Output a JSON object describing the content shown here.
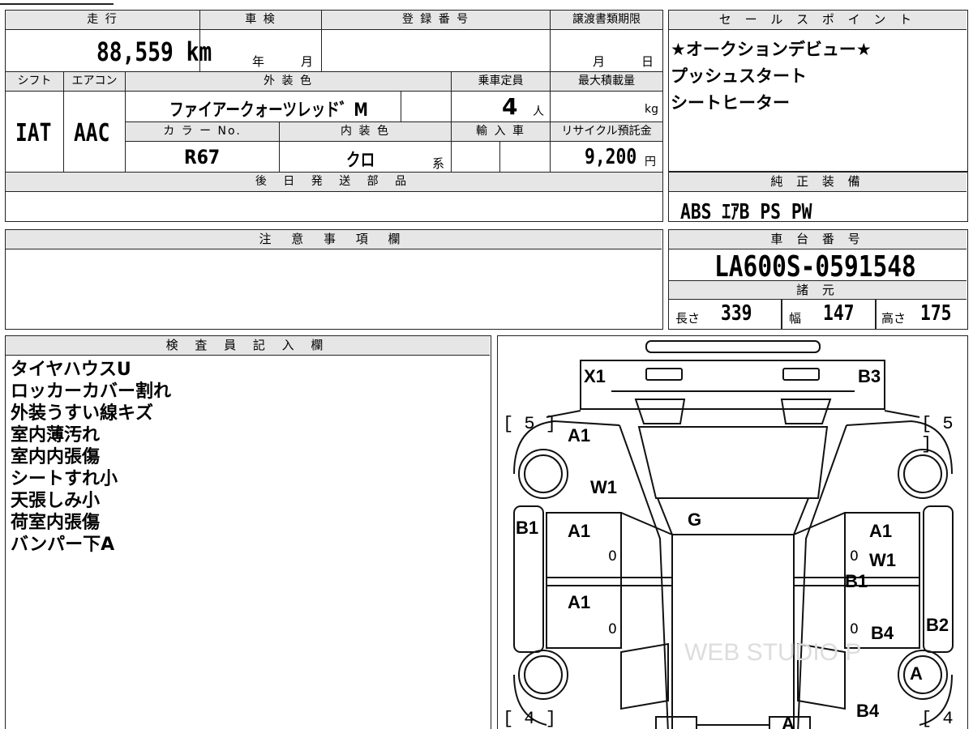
{
  "vehicle": {
    "mileage_label": "走 行",
    "mileage": "88,559",
    "mileage_unit": "km",
    "inspection_label": "車 検",
    "inspection_year": "年",
    "inspection_month": "月",
    "registration_label": "登 録 番 号",
    "transfer_label": "譲渡書類期限",
    "transfer_month": "月",
    "transfer_day": "日",
    "shift_label": "シフト",
    "shift": "IAT",
    "ac_label": "エアコン",
    "ac": "AAC",
    "exterior_label": "外 装 色",
    "exterior": "ファイアークォーツレッド゛M",
    "capacity_label": "乗車定員",
    "capacity": "4",
    "capacity_unit": "人",
    "max_load_label": "最大積載量",
    "max_load_unit": "kg",
    "color_no_label": "カ ラ ー No.",
    "color_no": "R67",
    "interior_label": "内 装 色",
    "interior": "クロ",
    "interior_unit": "系",
    "import_label": "輸 入 車",
    "recycle_label": "リサイクル預託金",
    "recycle": "9,200",
    "recycle_unit": "円",
    "later_parts_label": "後 日 発 送 部 品"
  },
  "sales_points": {
    "label": "セ ー ル ス ポ イ ン ト",
    "items": [
      "★オークションデビュー★",
      "プッシュスタート",
      "シートヒーター"
    ]
  },
  "equipment": {
    "label": "純 正 装 備",
    "value": "ABS ｴｱB PS PW"
  },
  "notes": {
    "label": "注 意 事 項 欄"
  },
  "chassis": {
    "label": "車 台 番 号",
    "value": "LA600S-0591548",
    "spec_label": "諸 元",
    "length_label": "長さ",
    "length": "339",
    "width_label": "幅",
    "width": "147",
    "height_label": "高さ",
    "height": "175"
  },
  "inspector": {
    "label": "検 査 員 記 入 欄",
    "items": [
      "タイヤハウスU",
      "ロッカーカバー割れ",
      "外装うすい線キズ",
      "室内薄汚れ",
      "室内内張傷",
      "シートすれ小",
      "天張しみ小",
      "荷室内張傷",
      "バンパー下A"
    ]
  },
  "diagram": {
    "tire_fl": "[ 5 ]",
    "tire_fr": "[ 5 ]",
    "tire_rl": "[ 4 ]",
    "tire_rr": "[ 4 ]",
    "marks": {
      "x1": "X1",
      "b3": "B3",
      "a1_hood": "A1",
      "w1_left": "W1",
      "g": "G",
      "b1_left": "B1",
      "a1_fl_door": "A1",
      "a1_rl_door": "A1",
      "a1_fr_door": "A1",
      "w1_right": "W1",
      "b1_right": "B1",
      "b2": "B2",
      "b4_door": "B4",
      "a_wheel": "A",
      "b4_rear": "B4",
      "a_rear": "A",
      "zero_1": "0",
      "zero_2": "0",
      "zero_3": "0",
      "zero_4": "0"
    }
  }
}
